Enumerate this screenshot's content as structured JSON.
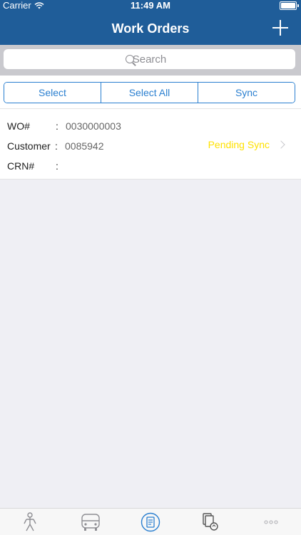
{
  "status_bar": {
    "carrier": "Carrier",
    "time": "11:49 AM",
    "battery_level": 1.0
  },
  "nav": {
    "title": "Work Orders",
    "add_icon": "plus-icon"
  },
  "search": {
    "placeholder": "Search",
    "value": ""
  },
  "segments": [
    "Select",
    "Select All",
    "Sync"
  ],
  "work_order": {
    "wo_label": "WO#",
    "wo_value": "0030000003",
    "customer_label": "Customer",
    "customer_value": "0085942",
    "crn_label": "CRN#",
    "crn_value": "",
    "status": "Pending Sync"
  },
  "tabs": [
    {
      "icon": "person-icon"
    },
    {
      "icon": "truck-icon"
    },
    {
      "icon": "work-orders-icon",
      "active": true
    },
    {
      "icon": "sync-documents-icon"
    },
    {
      "icon": "more-icon"
    }
  ],
  "colors": {
    "nav": "#1f5d99",
    "accent": "#2a7fd0",
    "pending": "#ffe100",
    "background": "#efeff4"
  }
}
